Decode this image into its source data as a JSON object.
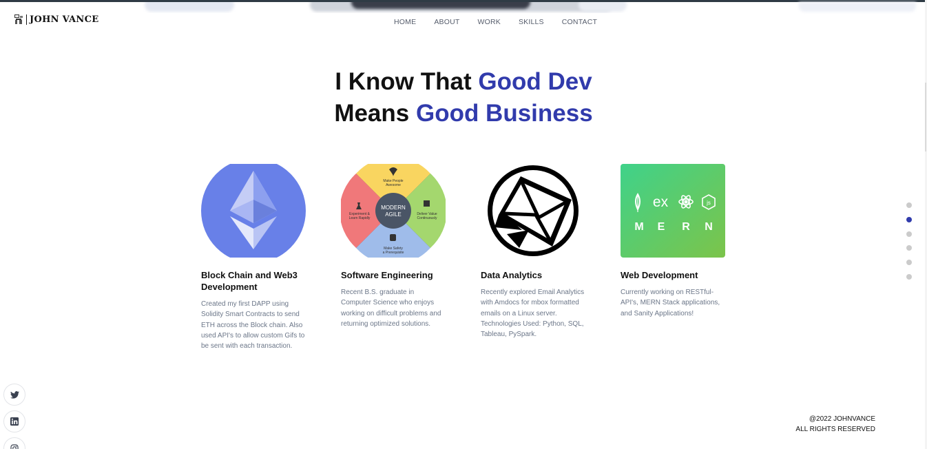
{
  "brand": {
    "name": "JOHN VANCE"
  },
  "nav": {
    "items": [
      {
        "label": "HOME"
      },
      {
        "label": "ABOUT"
      },
      {
        "label": "WORK"
      },
      {
        "label": "SKILLS"
      },
      {
        "label": "CONTACT"
      }
    ]
  },
  "headline": {
    "line1_plain": "I Know That ",
    "line1_accent": "Good Dev",
    "line2_plain": "Means ",
    "line2_accent": "Good Business"
  },
  "cards": [
    {
      "title": "Block Chain and Web3 Development",
      "description": "Created my first DAPP using Solidity Smart Contracts to send ETH across the Block chain. Also used API's to allow custom Gifs to be sent with each transaction.",
      "image": "ethereum-logo"
    },
    {
      "title": "Software Engineering",
      "description": "Recent B.S. graduate in Computer Science who enjoys working on difficult problems and returning optimized solutions.",
      "image": "modern-agile-wheel",
      "wheel": {
        "center": "MODERN\nAGILE",
        "top": "Make People\nAwesome",
        "right": "Deliver Value\nContinuously",
        "bottom": "Make Safety\na Prerequisite",
        "left": "Experiment &\nLearn Rapidly"
      }
    },
    {
      "title": "Data Analytics",
      "description": "Recently explored Email Analytics with Amdocs for mbox formatted emails on a Linux server. Technologies Used: Python, SQL, Tableau, PySpark.",
      "image": "mail-envelope-logo"
    },
    {
      "title": "Web Development",
      "description": "Currently working on RESTful-API's, MERN Stack applications, and Sanity Applications!",
      "image": "mern-stack",
      "mern": {
        "letters": [
          "M",
          "E",
          "R",
          "N"
        ],
        "ex": "ex"
      }
    }
  ],
  "social": [
    {
      "icon": "twitter-icon"
    },
    {
      "icon": "linkedin-icon"
    },
    {
      "icon": "instagram-icon"
    }
  ],
  "section_dots": {
    "count": 6,
    "active_index": 1
  },
  "footer": {
    "line1": "@2022 JOHNVANCE",
    "line2": "ALL RIGHTS RESERVED"
  },
  "colors": {
    "accent": "#313bac",
    "muted": "#6b7688"
  }
}
